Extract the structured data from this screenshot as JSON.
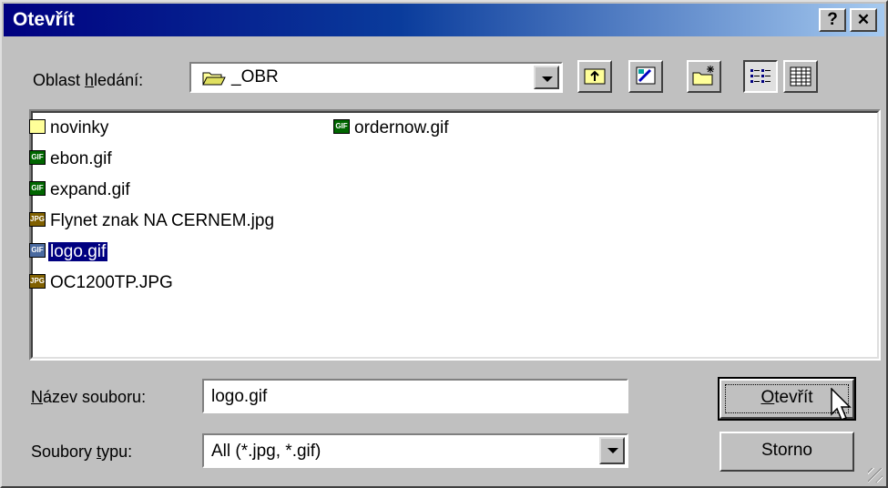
{
  "dialog": {
    "title": "Otevřít",
    "help_label": "?",
    "close_label": "✕"
  },
  "lookin": {
    "label_pre": "Oblast ",
    "label_ul": "h",
    "label_post": "ledání:",
    "value": "_OBR"
  },
  "toolbar": {
    "buttons": [
      "up-folder",
      "desktop",
      "new-folder",
      "list-view",
      "details-view"
    ],
    "pressed": "list-view"
  },
  "files": [
    {
      "name": "novinky",
      "icon": "folder-icon"
    },
    {
      "name": "ebon.gif",
      "icon": "gif-icon",
      "badge": "GIF"
    },
    {
      "name": "expand.gif",
      "icon": "gif-icon",
      "badge": "GIF"
    },
    {
      "name": "Flynet znak NA CERNEM.jpg",
      "icon": "jpg-icon",
      "badge": "JPG"
    },
    {
      "name": "logo.gif",
      "icon": "gif-icon",
      "badge": "GIF",
      "selected": true
    },
    {
      "name": "OC1200TP.JPG",
      "icon": "jpg-icon",
      "badge": "JPG"
    },
    {
      "name": "ordernow.gif",
      "icon": "gif-icon",
      "badge": "GIF"
    }
  ],
  "filename": {
    "label_ul": "N",
    "label_post": "ázev souboru:",
    "value": "logo.gif"
  },
  "filetype": {
    "label_pre": "Soubory ",
    "label_ul": "t",
    "label_post": "ypu:",
    "value": "All (*.jpg, *.gif)"
  },
  "buttons": {
    "open_ul": "O",
    "open_post": "tevřít",
    "cancel": "Storno"
  }
}
